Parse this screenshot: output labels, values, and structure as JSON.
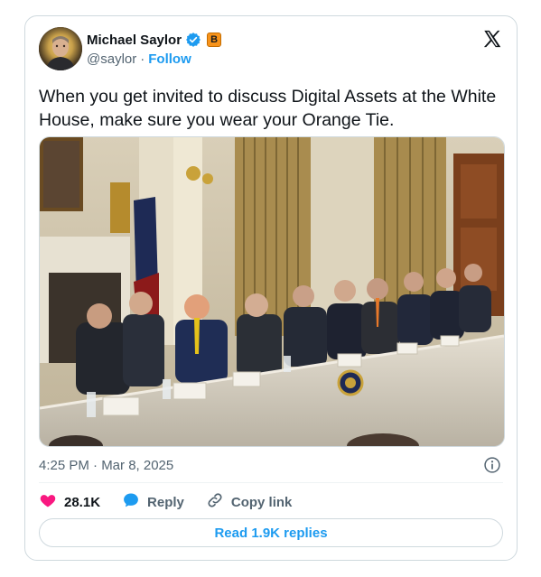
{
  "author": {
    "name": "Michael Saylor",
    "handle": "@saylor",
    "separator": "·",
    "follow_label": "Follow",
    "badge_letter": "B"
  },
  "tweet": {
    "text": "When you get invited to discuss Digital Assets at the White House, make sure you wear your Orange Tie.",
    "timestamp": "4:25 PM · Mar 8, 2025"
  },
  "actions": {
    "likes": "28.1K",
    "reply_label": "Reply",
    "copy_link_label": "Copy link"
  },
  "replies_button": "Read 1.9K replies",
  "colors": {
    "accent": "#1d9bf0",
    "like": "#f91880",
    "verified": "#1d9bf0",
    "bitcoin_orange": "#f7931a",
    "muted_text": "#536471"
  },
  "icons": [
    "x-logo-icon",
    "verified-badge-icon",
    "bitcoin-badge-icon",
    "info-icon",
    "heart-icon",
    "reply-bubble-icon",
    "link-icon"
  ]
}
